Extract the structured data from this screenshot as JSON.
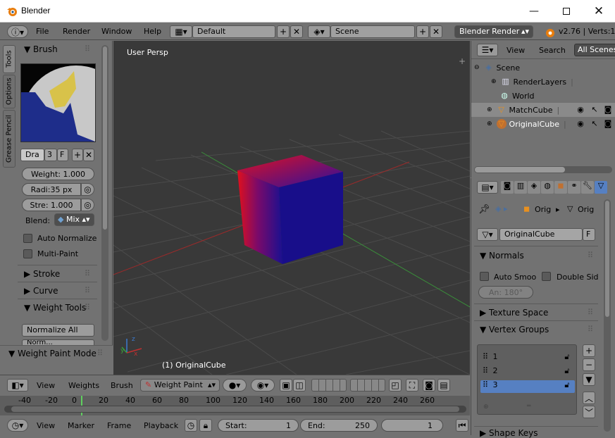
{
  "window": {
    "title": "Blender"
  },
  "info": {
    "menus": [
      "File",
      "Render",
      "Window",
      "Help"
    ],
    "layout": "Default",
    "scene": "Scene",
    "engine": "Blender Render",
    "version": "v2.76 | Verts:1"
  },
  "tabs": [
    "Tools",
    "Options",
    "Grease Pencil"
  ],
  "tools": {
    "brush_header": "Brush",
    "brush_name": "Dra",
    "brush_users": "3",
    "brush_fake": "F",
    "weight": "Weight:  1.000",
    "radius": "Radi:35 px",
    "strength": "Stre: 1.000",
    "blend_label": "Blend:",
    "blend_value": "Mix",
    "auto_normalize": "Auto Normalize",
    "multi_paint": "Multi-Paint",
    "stroke": "Stroke",
    "curve": "Curve",
    "weight_tools": "Weight Tools",
    "normalize_all": "Normalize All",
    "normalize_cut": "Norm...",
    "mode_panel": "Weight Paint Mode"
  },
  "viewport": {
    "persp_label": "User Persp",
    "object_label": "(1) OriginalCube",
    "colors": {
      "bg": "#393939",
      "grid": "#4b4b4b",
      "xaxis": "#b02a2a",
      "yaxis": "#3a9a3a",
      "cube_red": "#e0101c",
      "cube_blue": "#1a1090"
    }
  },
  "viewheader": {
    "menus": [
      "View",
      "Weights",
      "Brush"
    ],
    "mode": "Weight Paint"
  },
  "timeline": {
    "ticks": [
      "-40",
      "-20",
      "0",
      "20",
      "40",
      "60",
      "80",
      "100",
      "120",
      "140",
      "160",
      "180",
      "200",
      "220",
      "240",
      "260"
    ],
    "menus": [
      "View",
      "Marker",
      "Frame",
      "Playback"
    ],
    "start": "Start:",
    "start_val": "1",
    "end": "End:",
    "end_val": "250",
    "current": "1"
  },
  "outliner": {
    "menus": [
      "View",
      "Search",
      "All Scenes"
    ],
    "items": [
      {
        "label": "Scene"
      },
      {
        "label": "RenderLayers"
      },
      {
        "label": "World"
      },
      {
        "label": "MatchCube"
      },
      {
        "label": "OriginalCube"
      }
    ]
  },
  "properties": {
    "crumb_1": "Orig",
    "crumb_2": "Orig",
    "object_name": "OriginalCube",
    "object_f": "F",
    "normals": "Normals",
    "auto_smooth": "Auto Smoo",
    "double_sided": "Double Sid",
    "angle": "An: 180°",
    "texture_space": "Texture Space",
    "vertex_groups": "Vertex Groups",
    "groups": [
      "1",
      "2",
      "3"
    ],
    "shape_keys": "Shape Keys"
  }
}
